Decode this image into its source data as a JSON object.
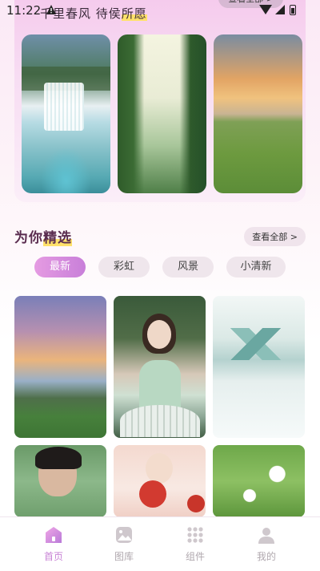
{
  "status_bar": {
    "time": "11:22",
    "icons": [
      "warning-icon",
      "wifi-icon",
      "signal-icon",
      "battery-icon"
    ]
  },
  "top_section": {
    "title_prefix": "千里春风 待侯",
    "title_highlight": "所愿",
    "more_label": "查看全部 >",
    "thumbnails": [
      "waterfall",
      "forest-road",
      "grassland-sunset"
    ]
  },
  "recommend": {
    "title_prefix": "为你",
    "title_highlight": "精选",
    "more_label": "查看全部 >"
  },
  "tabs": [
    {
      "label": "最新",
      "active": true
    },
    {
      "label": "彩虹",
      "active": false
    },
    {
      "label": "风景",
      "active": false
    },
    {
      "label": "小清新",
      "active": false
    }
  ],
  "grid": [
    "sunset-hills",
    "girl-umbrella",
    "ink-plum-blossom",
    "young-man",
    "girl-red-balloon",
    "white-flowers"
  ],
  "nav": [
    {
      "label": "首页",
      "icon": "home-icon",
      "active": true
    },
    {
      "label": "图库",
      "icon": "gallery-icon",
      "active": false
    },
    {
      "label": "组件",
      "icon": "grid-icon",
      "active": false
    },
    {
      "label": "我的",
      "icon": "profile-icon",
      "active": false
    }
  ],
  "colors": {
    "accent": "#c884d6",
    "highlight": "#ffe16a",
    "title": "#5a2c4f"
  }
}
